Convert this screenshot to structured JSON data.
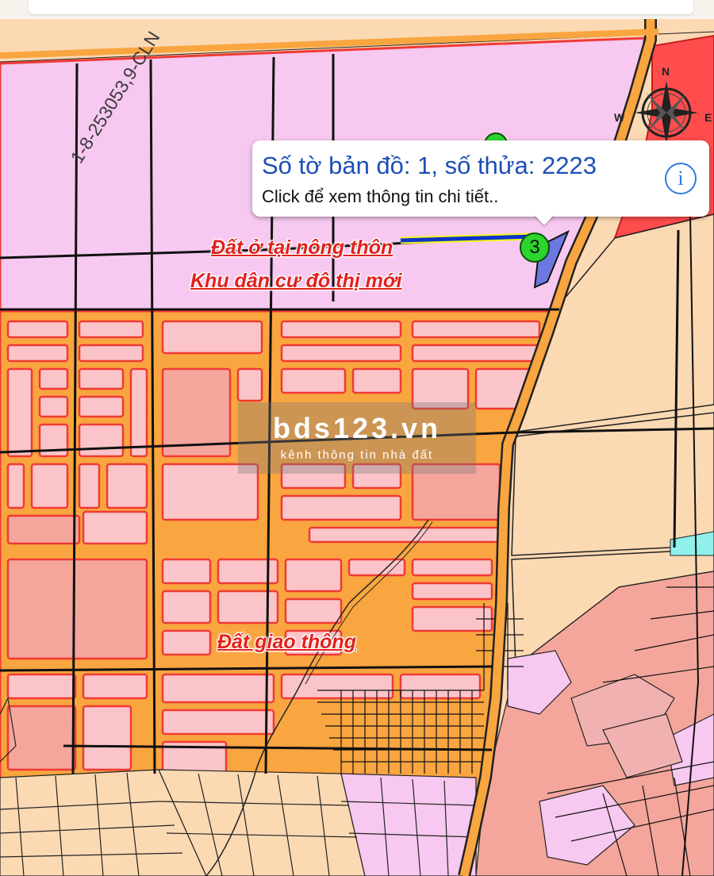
{
  "popup": {
    "title": "Số tờ bản đồ: 1, số thửa: 2223",
    "subtitle": "Click để xem thông tin chi tiết..",
    "info_icon": "i"
  },
  "labels": {
    "parcel_code": "1-8-253053,9-CLN",
    "zone_rural": "Đất ở tại nông thôn",
    "zone_urban": "Khu dân cư đô thị mới",
    "zone_traffic": "Đất giao thông"
  },
  "marker": {
    "number": "3"
  },
  "compass": {
    "north": "N",
    "east": "E",
    "west": "W"
  },
  "watermark": {
    "title": "bds123.vn",
    "subtitle": "kênh thông tin nhà đất"
  },
  "colors": {
    "residential_pink": "#f7c8f0",
    "urban_block_pink": "#fbc4c9",
    "road_orange": "#f9a540",
    "commercial_red": "#ff4d4d",
    "agri_tan": "#fbd9b3",
    "water_cyan": "#8ff0ec",
    "highlight_yellow": "#f7f51c",
    "selection_blue": "#0b35c9"
  }
}
